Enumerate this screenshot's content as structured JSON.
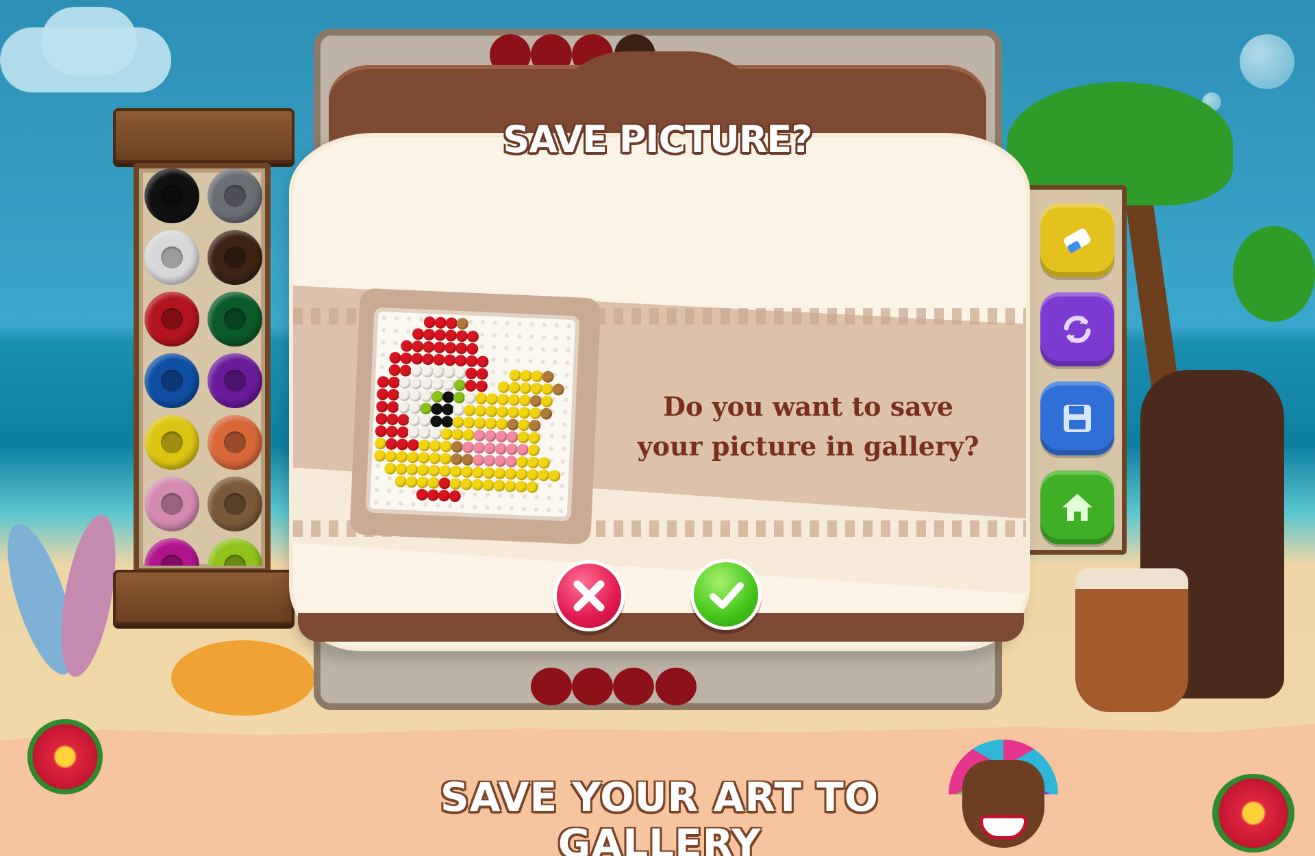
{
  "dialog": {
    "title": "SAVE PICTURE?",
    "question": "Do you want to save your picture in gallery?",
    "cancel_icon": "close-icon",
    "confirm_icon": "checkmark-icon"
  },
  "banner": {
    "title": "SAVE YOUR ART TO GALLERY"
  },
  "palette": {
    "colors": [
      "#111111",
      "#6b6e74",
      "#d8d8d8",
      "#3b2414",
      "#b3141f",
      "#0b5a2a",
      "#0f4fa3",
      "#6a1b9a",
      "#dcc512",
      "#d8683a",
      "#d48ab0",
      "#7a5a3a",
      "#b0148a",
      "#8fc21a"
    ]
  },
  "tools": [
    {
      "name": "eraser",
      "icon": "eraser-icon",
      "color": "#e3c21f"
    },
    {
      "name": "reset",
      "icon": "refresh-icon",
      "color": "#7c3bd1"
    },
    {
      "name": "save",
      "icon": "save-icon",
      "color": "#2f6fd6"
    },
    {
      "name": "home",
      "icon": "home-icon",
      "color": "#3fb025"
    }
  ],
  "colors": {
    "frame_brown": "#7e4a34",
    "question_text": "#7a2f1e",
    "cancel_red": "#e0194f",
    "confirm_green": "#42c51a"
  }
}
